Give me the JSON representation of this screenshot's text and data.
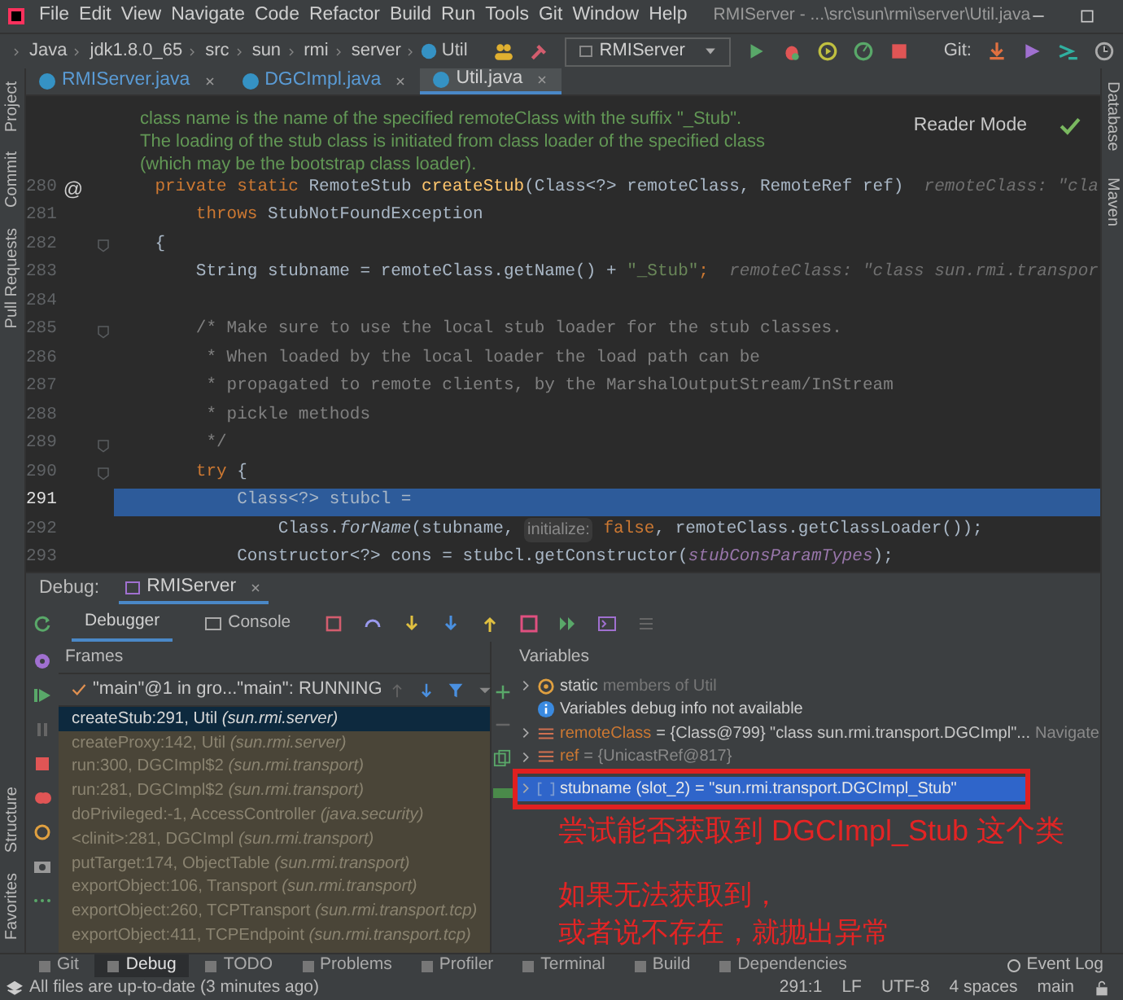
{
  "menu_bar": {
    "items": [
      "File",
      "Edit",
      "View",
      "Navigate",
      "Code",
      "Refactor",
      "Build",
      "Run",
      "Tools",
      "Git",
      "Window",
      "Help"
    ],
    "title": "RMIServer - ...\\src\\sun\\rmi\\server\\Util.java"
  },
  "nav_bar": {
    "breadcrumbs": [
      "Java",
      "jdk1.8.0_65",
      "src",
      "sun",
      "rmi",
      "server",
      "Util"
    ],
    "run_config": "RMIServer",
    "vcs_label": "Git:"
  },
  "editor_tabs": [
    {
      "label": "RMIServer.java",
      "selected": false
    },
    {
      "label": "DGCImpl.java",
      "selected": false
    },
    {
      "label": "Util.java",
      "selected": true
    }
  ],
  "left_stripe_top": [
    "Project",
    "Commit",
    "Pull Requests"
  ],
  "left_stripe_bottom": [
    "Structure",
    "Favorites"
  ],
  "right_stripe": [
    "Database",
    "Maven"
  ],
  "editor": {
    "doc_lines": [
      "class name is the name of the specified remoteClass with the suffix \"_Stub\".",
      "The loading of the stub class is initiated from class loader of the specified class",
      "(which may be the bootstrap class loader)."
    ],
    "reader_mode": "Reader Mode",
    "lines": [
      {
        "number": "280",
        "gutter_mark": "@",
        "fold_marker": false,
        "highlighted": false,
        "segments": [
          {
            "kind": "keyword",
            "text": "    private static "
          },
          {
            "kind": "plain",
            "text": "RemoteStub "
          },
          {
            "kind": "method",
            "text": "createStub"
          },
          {
            "kind": "plain",
            "text": "(Class<?> remoteClass, RemoteRef ref)"
          },
          {
            "kind": "hint",
            "text": "  remoteClass: \"cla"
          }
        ]
      },
      {
        "number": "281",
        "fold_marker": false,
        "highlighted": false,
        "segments": [
          {
            "kind": "keyword",
            "text": "        throws "
          },
          {
            "kind": "plain",
            "text": "StubNotFoundException"
          }
        ]
      },
      {
        "number": "282",
        "fold_marker": true,
        "highlighted": false,
        "segments": [
          {
            "kind": "plain",
            "text": "    {"
          }
        ]
      },
      {
        "number": "283",
        "fold_marker": false,
        "highlighted": false,
        "segments": [
          {
            "kind": "plain",
            "text": "        String stubname = remoteClass.getName() + "
          },
          {
            "kind": "string",
            "text": "\"_Stub\""
          },
          {
            "kind": "keyword",
            "text": ";"
          },
          {
            "kind": "hint",
            "text": "  remoteClass: \"class sun.rmi.transpor"
          }
        ]
      },
      {
        "number": "284",
        "fold_marker": false,
        "highlighted": false
      },
      {
        "number": "285",
        "fold_marker": true,
        "highlighted": false,
        "segments": [
          {
            "kind": "comment",
            "text": "        /* Make sure to use the local stub loader for the stub classes."
          }
        ]
      },
      {
        "number": "286",
        "fold_marker": false,
        "highlighted": false,
        "segments": [
          {
            "kind": "comment",
            "text": "         * When loaded by the local loader the load path can be"
          }
        ]
      },
      {
        "number": "287",
        "fold_marker": false,
        "highlighted": false,
        "segments": [
          {
            "kind": "comment",
            "text": "         * propagated to remote clients, by the MarshalOutputStream/InStream"
          }
        ]
      },
      {
        "number": "288",
        "fold_marker": false,
        "highlighted": false,
        "segments": [
          {
            "kind": "comment",
            "text": "         * pickle methods"
          }
        ]
      },
      {
        "number": "289",
        "fold_marker": true,
        "highlighted": false,
        "segments": [
          {
            "kind": "comment",
            "text": "         */"
          }
        ]
      },
      {
        "number": "290",
        "fold_marker": true,
        "highlighted": false,
        "segments": [
          {
            "kind": "keyword",
            "text": "        try "
          },
          {
            "kind": "plain",
            "text": "{"
          }
        ]
      },
      {
        "number": "291",
        "fold_marker": false,
        "highlighted": true,
        "segments": [
          {
            "kind": "plain",
            "text": "            Class<?> stubcl ="
          }
        ]
      },
      {
        "number": "292",
        "fold_marker": false,
        "highlighted": false,
        "segments": [
          {
            "kind": "plain",
            "text": "                Class."
          },
          {
            "kind": "static_method",
            "text": "forName"
          },
          {
            "kind": "plain",
            "text": "(stubname, "
          },
          {
            "kind": "inlay",
            "text": "initialize:"
          },
          {
            "kind": "keyword",
            "text": " false"
          },
          {
            "kind": "plain",
            "text": ", remoteClass.getClassLoader());"
          }
        ]
      },
      {
        "number": "293",
        "fold_marker": false,
        "highlighted": false,
        "segments": [
          {
            "kind": "plain",
            "text": "            Constructor<?> cons = stubcl.getConstructor("
          },
          {
            "kind": "field",
            "text": "stubConsParamTypes"
          },
          {
            "kind": "plain",
            "text": ");"
          }
        ]
      }
    ]
  },
  "debug": {
    "label": "Debug:",
    "session_tab": "RMIServer",
    "tabs": [
      {
        "label": "Debugger",
        "selected": true
      },
      {
        "label": "Console",
        "selected": false
      }
    ],
    "frames_title": "Frames",
    "thread": "\"main\"@1 in gro...\"main\": RUNNING",
    "frames": [
      {
        "method": "createStub:291, Util",
        "package": "(sun.rmi.server)",
        "selected": true
      },
      {
        "method": "createProxy:142, Util",
        "package": "(sun.rmi.server)",
        "selected": false
      },
      {
        "method": "run:300, DGCImpl$2",
        "package": "(sun.rmi.transport)",
        "selected": false
      },
      {
        "method": "run:281, DGCImpl$2",
        "package": "(sun.rmi.transport)",
        "selected": false
      },
      {
        "method": "doPrivileged:-1, AccessController",
        "package": "(java.security)",
        "selected": false
      },
      {
        "method": "<clinit>:281, DGCImpl",
        "package": "(sun.rmi.transport)",
        "selected": false
      },
      {
        "method": "putTarget:174, ObjectTable",
        "package": "(sun.rmi.transport)",
        "selected": false
      },
      {
        "method": "exportObject:106, Transport",
        "package": "(sun.rmi.transport)",
        "selected": false
      },
      {
        "method": "exportObject:260, TCPTransport",
        "package": "(sun.rmi.transport.tcp)",
        "selected": false
      },
      {
        "method": "exportObject:411, TCPEndpoint",
        "package": "(sun.rmi.transport.tcp)",
        "selected": false
      }
    ],
    "variables_title": "Variables",
    "variables": [
      {
        "kind": "static",
        "name": "static",
        "value": "members of Util",
        "selected": false
      },
      {
        "kind": "info",
        "value": "Variables debug info not available",
        "selected": false
      },
      {
        "kind": "field",
        "name": "remoteClass",
        "value": "= {Class@799} \"class sun.rmi.transport.DGCImpl\"...",
        "link": "Navigate",
        "selected": false
      },
      {
        "kind": "field",
        "name": "ref",
        "value": "= {UnicastRef@817}",
        "selected": false
      },
      {
        "kind": "local",
        "name": "stubname (slot_2)",
        "value": "= \"sun.rmi.transport.DGCImpl_Stub\"",
        "selected": true
      }
    ]
  },
  "annotation": {
    "headline": "尝试能否获取到 DGCImpl_Stub 这个类",
    "note_lines": [
      "如果无法获取到，",
      "或者说不存在，就抛出异常"
    ]
  },
  "tool_window_bar": [
    {
      "label": "Git",
      "selected": false
    },
    {
      "label": "Debug",
      "selected": true
    },
    {
      "label": "TODO",
      "selected": false
    },
    {
      "label": "Problems",
      "selected": false
    },
    {
      "label": "Profiler",
      "selected": false
    },
    {
      "label": "Terminal",
      "selected": false
    },
    {
      "label": "Build",
      "selected": false
    },
    {
      "label": "Dependencies",
      "selected": false
    }
  ],
  "event_log": "Event Log",
  "status_bar": {
    "message": "All files are up-to-date (3 minutes ago)",
    "items": [
      "291:1",
      "LF",
      "UTF-8",
      "4 spaces",
      "main"
    ]
  }
}
